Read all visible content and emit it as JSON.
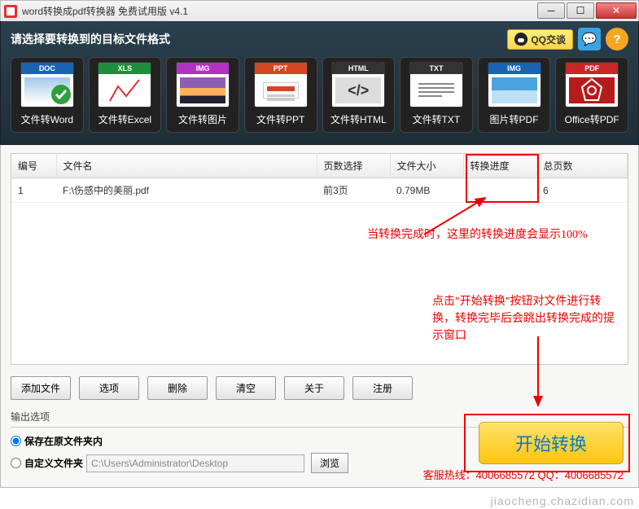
{
  "title": "word转换成pdf转换器 免费试用版 v4.1",
  "subtitle": "请选择要转换到的目标文件格式",
  "qq_button": "QQ交谈",
  "filetypes": [
    {
      "badge": "DOC",
      "badgeColor": "#1a63b3",
      "label": "文件转Word",
      "innerBg": "linear-gradient(#a3c9e8,#fff)",
      "check": true
    },
    {
      "badge": "XLS",
      "badgeColor": "#1e8e3e",
      "label": "文件转Excel",
      "innerBg": "#fff",
      "excel": true
    },
    {
      "badge": "IMG",
      "badgeColor": "#b233c2",
      "label": "文件转图片",
      "innerBg": "linear-gradient(#8c5fb3 40%,#ffb05a 40%,#ffb05a 70%,#223 70%)"
    },
    {
      "badge": "PPT",
      "badgeColor": "#d24726",
      "label": "文件转PPT",
      "innerBg": "linear-gradient(#fff,#fff)",
      "ppt": true
    },
    {
      "badge": "HTML",
      "badgeColor": "#333",
      "label": "文件转HTML",
      "innerBg": "#ddd",
      "html": true
    },
    {
      "badge": "TXT",
      "badgeColor": "#333",
      "label": "文件转TXT",
      "innerBg": "#fff",
      "txt": true
    },
    {
      "badge": "IMG",
      "badgeColor": "#1a63b3",
      "label": "图片转PDF",
      "innerBg": "linear-gradient(#4aa3df 50%,#bde0f7 50%)"
    },
    {
      "badge": "PDF",
      "badgeColor": "#c62828",
      "label": "Office转PDF",
      "innerBg": "#b71c1c",
      "pdf": true
    }
  ],
  "table": {
    "headers": {
      "no": "编号",
      "name": "文件名",
      "pages": "页数选择",
      "size": "文件大小",
      "progress": "转换进度",
      "total": "总页数"
    },
    "rows": [
      {
        "no": "1",
        "name": "F:\\伤感中的美丽.pdf",
        "pages": "前3页",
        "size": "0.79MB",
        "progress": "",
        "total": "6"
      }
    ]
  },
  "annotations": {
    "progress_note": "当转换完成时，这里的转换进度会显示100%",
    "start_note": "点击\"开始转换\"按钮对文件进行转换，转换完毕后会跳出转换完成的提示窗口"
  },
  "buttons": {
    "add": "添加文件",
    "options": "选项",
    "delete": "删除",
    "clear": "清空",
    "about": "关于",
    "register": "注册",
    "start": "开始转换",
    "browse": "浏览"
  },
  "output": {
    "header": "输出选项",
    "opt1": "保存在原文件夹内",
    "opt2": "自定义文件夹",
    "path": "C:\\Users\\Administrator\\Desktop"
  },
  "hotline": "客服热线：4006685572 QQ：4006685572",
  "watermark": "jiaocheng.chazidian.com"
}
